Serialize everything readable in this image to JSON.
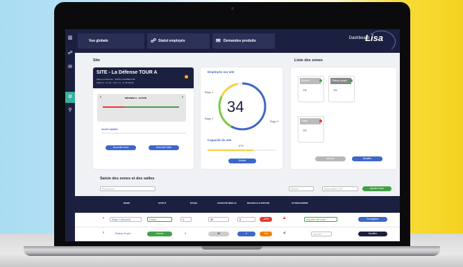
{
  "tabs": {
    "overview": "Vue globale",
    "staff": "Statut employés",
    "requests": "Demandes produits"
  },
  "header": {
    "dashboard": "Dashboard",
    "logo": "Lisa"
  },
  "site": {
    "section": "Site",
    "name": "SITE - La Défense TOUR A",
    "addr1": "Place La Défense · 92100 COURBEVOIE",
    "addr2": "1969 m² · N° 24 · 0 27 ° N · 4° 09' 58.09",
    "selector": "DÉFENSE A · ACTION",
    "quick_access": "Accès rapides",
    "btn_zone": "Nouvelle Zone",
    "btn_room": "Nouvelle Salle"
  },
  "employees": {
    "title": "Employés sur site",
    "count": "34",
    "floor1": "Étage 1",
    "floor2": "Étage 2",
    "floor3": "Étage 3",
    "capacity": "Capacité du site",
    "capacity_pct": "67%",
    "btn": "Détails"
  },
  "zones": {
    "title": "Liste des zones",
    "z1": "Accueil",
    "z2": "Plateau projet",
    "z3": "Cafés",
    "v1": "236",
    "v2": "250",
    "v3": "200",
    "btn_a": "Annuler",
    "btn_b": "Modifier"
  },
  "table": {
    "title": "Saisie des zones et des salles",
    "search_ph": "Rechercher",
    "btn_add": "Ajouter Zone",
    "filter_a": "Niveau",
    "filter_b": "Alimentation ZSY",
    "h1": "NOMS",
    "h2": "STATUT",
    "h3": "ÉTAGE",
    "h4": "CAPACITÉ RÉELLE",
    "h5": "NOUVELLE CAPACITÉ",
    "h6": "ACTION RAPIDE",
    "r1": "Étage 1 (Accueil)",
    "r1s": "Ouvert",
    "r1f": "1",
    "r1c": "30",
    "r1n": "5",
    "r1p": "-20%",
    "r1a": "Importer QR code",
    "r1b": "Enregistrer",
    "r2": "Plateau Projet",
    "r2s": "Ouvert",
    "r2f": "1",
    "r2c": "30",
    "r2n": "0",
    "r2p": "-5%",
    "r2a": "Annuler",
    "r2b": "Modifier"
  }
}
